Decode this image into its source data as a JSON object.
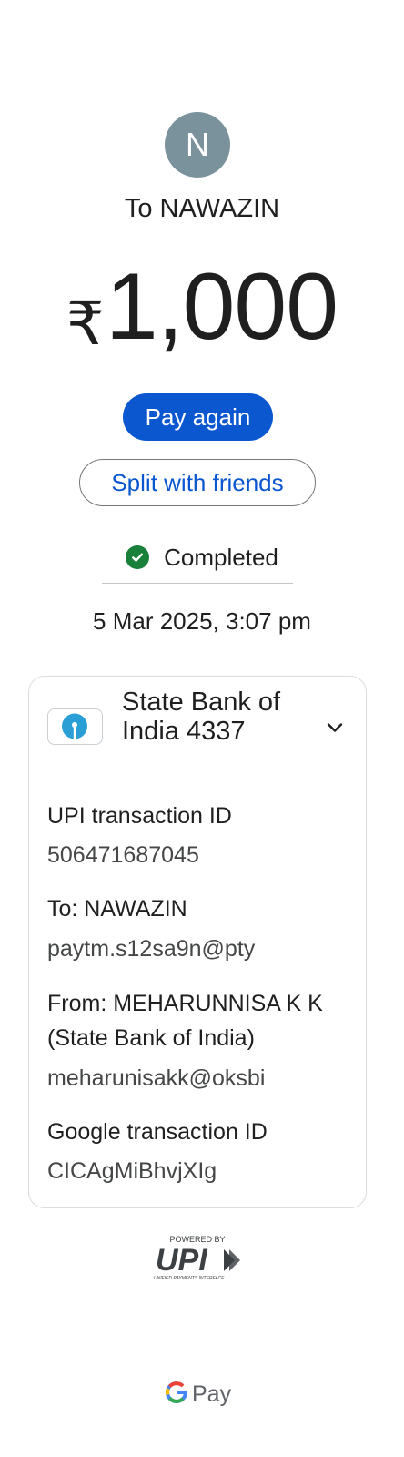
{
  "header": {
    "avatar_initial": "N",
    "to_name": "To NAWAZIN",
    "currency_symbol": "₹",
    "amount": "1,000"
  },
  "actions": {
    "pay_again": "Pay again",
    "split_with_friends": "Split with friends"
  },
  "status": {
    "text": "Completed",
    "color": "#188038",
    "date": "5 Mar 2025, 3:07 pm"
  },
  "details": {
    "bank_name": "State Bank of India 4337",
    "bank_name_line1": "State Bank of",
    "bank_name_line2": "India 4337",
    "upi_txn_label": "UPI transaction ID",
    "upi_txn_id": "506471687045",
    "to_label": "To: NAWAZIN",
    "to_vpa": "paytm.s12sa9n@pty",
    "from_label_line1": "From: MEHARUNNISA  K K",
    "from_label_line2": "(State Bank of India)",
    "from_vpa": "meharunisakk@oksbi",
    "google_txn_label": "Google transaction ID",
    "google_txn_id": "CICAgMiBhvjXIg"
  },
  "footer": {
    "powered_by": "POWERED BY",
    "upi_logo_text": "UPI",
    "upi_tagline": "UNIFIED PAYMENTS INTERFACE",
    "gpay_text": "Pay"
  },
  "colors": {
    "primary": "#0b57d0",
    "success": "#188038",
    "avatar_bg": "#7a929c"
  }
}
